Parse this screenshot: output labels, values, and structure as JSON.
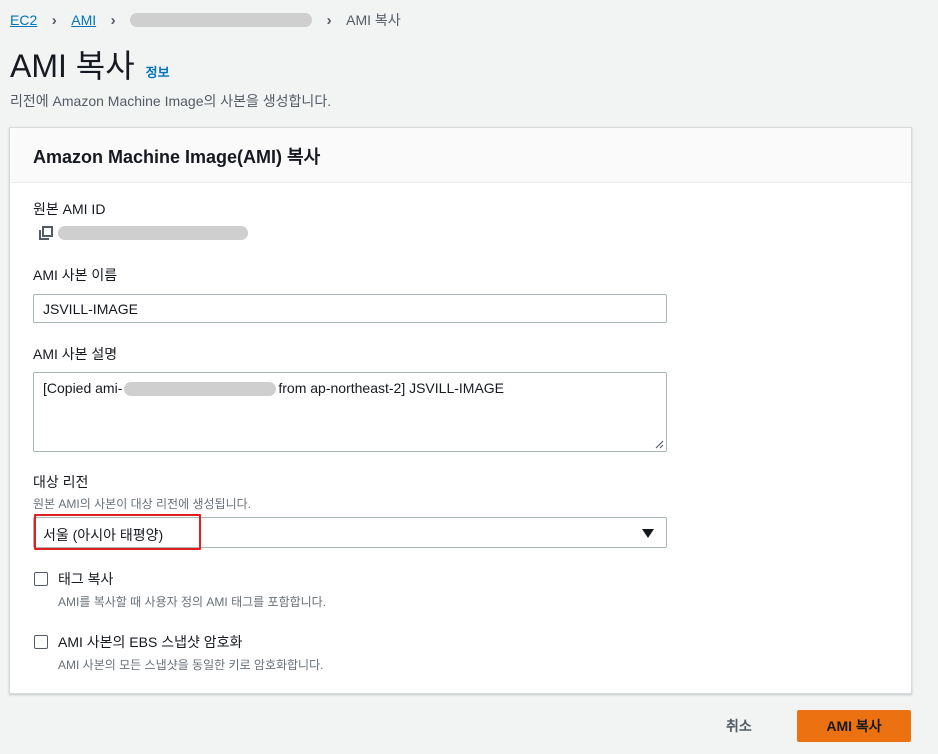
{
  "breadcrumb": {
    "items": [
      "EC2",
      "AMI"
    ],
    "current": "AMI 복사"
  },
  "page": {
    "title": "AMI 복사",
    "info_link": "정보",
    "subtitle": "리전에 Amazon Machine Image의 사본을 생성합니다."
  },
  "panel": {
    "heading": "Amazon Machine Image(AMI) 복사",
    "source_ami": {
      "label": "원본 AMI ID"
    },
    "copy_name": {
      "label": "AMI 사본 이름",
      "value": "JSVILL-IMAGE"
    },
    "copy_description": {
      "label": "AMI 사본 설명",
      "value_prefix": "[Copied ami-",
      "value_suffix": "from ap-northeast-2] JSVILL-IMAGE"
    },
    "destination_region": {
      "label": "대상 리전",
      "description": "원본 AMI의 사본이 대상 리전에 생성됩니다.",
      "selected": "서울 (아시아 태평양)"
    },
    "copy_tags": {
      "label": "태그 복사",
      "description": "AMI를 복사할 때 사용자 정의 AMI 태그를 포함합니다.",
      "checked": false
    },
    "encrypt": {
      "label": "AMI 사본의 EBS 스냅샷 암호화",
      "description": "AMI 사본의 모든 스냅샷을 동일한 키로 암호화합니다.",
      "checked": false
    }
  },
  "actions": {
    "cancel": "취소",
    "submit": "AMI 복사"
  },
  "colors": {
    "link": "#0073bb",
    "primary_button": "#ec7211",
    "highlight": "#e01f1f"
  }
}
